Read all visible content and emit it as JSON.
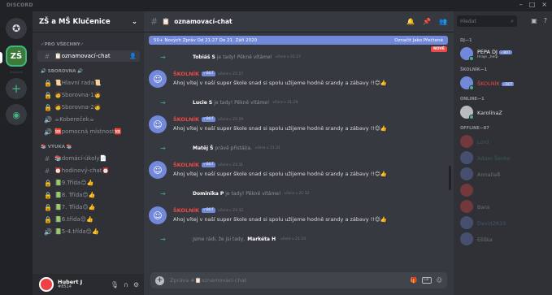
{
  "app": {
    "title": "DISCORD"
  },
  "colors": {
    "accent": "#7289da",
    "online": "#43b581",
    "danger": "#f04747",
    "background": "#36393f",
    "sidebar": "#2f3136"
  },
  "guilds": {
    "home_icon": "discord-logo-icon",
    "add_label": "+",
    "explore_icon": "compass-icon"
  },
  "server": {
    "name": "ZŠ a MŠ Klučenice",
    "categories": [
      {
        "label": "✓PRO VŠECHNY✓",
        "channels": [
          {
            "icon": "#",
            "label": "📋oznamovací-chat",
            "active": true
          }
        ]
      },
      {
        "label": "🔊 SBOROVNA 🔊",
        "channels": [
          {
            "icon": "🔒",
            "label": "📜Hlavní rada📜"
          },
          {
            "icon": "🔒",
            "label": "🧑Sborovna-1🧑"
          },
          {
            "icon": "🔒",
            "label": "🧑Sborovna-2🧑"
          },
          {
            "icon": "🔊",
            "label": "☕Kobereček☕"
          },
          {
            "icon": "🔊",
            "label": "🆘pomocná místnost🆘"
          }
        ]
      },
      {
        "label": "📚 VÝUKA 📚",
        "channels": [
          {
            "icon": "#",
            "label": "📚domácí-úkoly📄"
          },
          {
            "icon": "#",
            "label": "⏰hodinový-chat⏰"
          },
          {
            "icon": "🔒",
            "label": "📗9.Třída😊👍"
          },
          {
            "icon": "🔒",
            "label": "📗8. Třída😊👍"
          },
          {
            "icon": "🔒",
            "label": "📗7. Třída😊👍"
          },
          {
            "icon": "🔒",
            "label": "📗6.třída😊👍"
          },
          {
            "icon": "🔊",
            "label": "📗5-4.třída😊👍"
          }
        ]
      }
    ]
  },
  "user": {
    "name": "Hubert J",
    "tag": "#8514"
  },
  "chat": {
    "channel_name": "oznamovací-chat",
    "new_messages_banner": "50+ Nových Zpráv Od 21:27 Do 21. Září 2020",
    "mark_read_label": "Označit Jako Přečtené",
    "new_badge": "NOVÉ",
    "composer_placeholder": "Zpráva #📋oznamovací-chat",
    "bot_badge": "✓BOT",
    "bot_name": "ŠKOLNÍK",
    "bot_message": "Ahoj vítej v naší super škole snad si spolu užijeme hodně srandy a zábavy !!😊👍",
    "items": [
      {
        "kind": "system",
        "user": "Tobiáš S",
        "text": "je tady! Pěkně vítáme!",
        "time": "včera v 21:27"
      },
      {
        "kind": "bot",
        "time": "včera v 21:27"
      },
      {
        "kind": "system",
        "user": "Lucie S",
        "text": "je tady! Pěkně vítáme!",
        "time": "včera v 21:29"
      },
      {
        "kind": "bot",
        "time": "včera v 21:29"
      },
      {
        "kind": "system",
        "user": "Matěj Š",
        "text": "právě přistál/a.",
        "time": "včera v 21:31"
      },
      {
        "kind": "bot",
        "time": "včera v 21:31"
      },
      {
        "kind": "system",
        "user": "Dominika P",
        "text": "je tady! Pěkně vítáme!",
        "time": "včera v 21:32"
      },
      {
        "kind": "bot",
        "time": "včera v 21:32"
      },
      {
        "kind": "system_pre",
        "pre": "Jsme rádi, že jsi tady,",
        "user": "Markéta H",
        "time": "včera v 21:33"
      }
    ]
  },
  "members": {
    "search_placeholder": "Hledat",
    "groups": [
      {
        "label": "DJ—1",
        "items": [
          {
            "name": "PEPA DJ",
            "sub": "Hraje „help",
            "bot": true,
            "color": "#ffffff",
            "avatar": "#7289da",
            "status": "#43b581",
            "offline": false
          }
        ]
      },
      {
        "label": "ŠKOLNÍK—1",
        "items": [
          {
            "name": "ŠKOLNÍK",
            "sub": "",
            "bot": true,
            "color": "#f04747",
            "avatar": "#7289da",
            "status": "#43b581",
            "offline": false
          }
        ]
      },
      {
        "label": "ONLINE—1",
        "items": [
          {
            "name": "KarolínaZ",
            "sub": "",
            "bot": false,
            "color": "#dcddde",
            "avatar": "#b9bbbe",
            "status": "#43b581",
            "offline": false
          }
        ]
      },
      {
        "label": "OFFLINE—87",
        "items": [
          {
            "name": "Lord",
            "sub": "",
            "bot": false,
            "color": "#43b581",
            "avatar": "#f04747",
            "status": "",
            "offline": true
          },
          {
            "name": "Adam Šenko",
            "sub": "",
            "bot": false,
            "color": "#43b581",
            "avatar": "#7289da",
            "status": "",
            "offline": true
          },
          {
            "name": "Annaliaß",
            "sub": "",
            "bot": false,
            "color": "#dcddde",
            "avatar": "#7289da",
            "status": "",
            "offline": true
          },
          {
            "name": "",
            "sub": "",
            "bot": false,
            "color": "#f04747",
            "avatar": "#f04747",
            "status": "",
            "offline": true
          },
          {
            "name": "Bara",
            "sub": "",
            "bot": false,
            "color": "#dcddde",
            "avatar": "#f04747",
            "status": "",
            "offline": true
          },
          {
            "name": "David2810",
            "sub": "",
            "bot": false,
            "color": "#7289da",
            "avatar": "#7289da",
            "status": "",
            "offline": true
          },
          {
            "name": "Eliška",
            "sub": "",
            "bot": false,
            "color": "#dcddde",
            "avatar": "#7289da",
            "status": "",
            "offline": true
          }
        ]
      }
    ]
  }
}
